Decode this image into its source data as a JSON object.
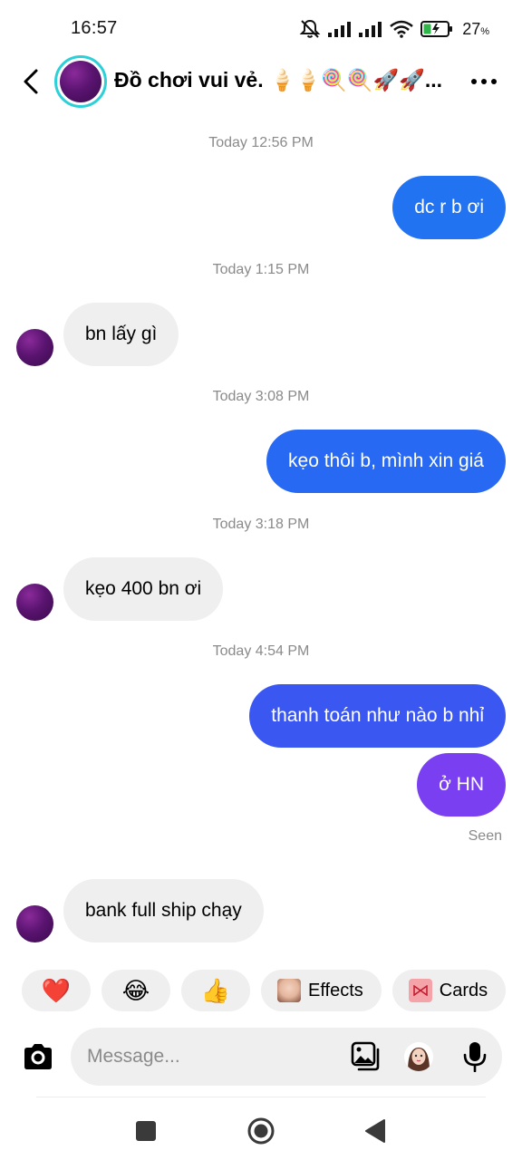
{
  "status_bar": {
    "time": "16:57",
    "battery_percent": "27",
    "battery_unit": "%",
    "icons": [
      "mute-icon",
      "signal-icon",
      "signal-icon",
      "wifi-icon",
      "battery-icon"
    ]
  },
  "header": {
    "title": "Đồ chơi vui vẻ. 🍦🍦🍭🍭🚀🚀...",
    "back_icon": "chevron-left-icon",
    "more_icon": "more-dots-icon"
  },
  "messages": [
    {
      "type": "timestamp",
      "text": "Today 12:56 PM"
    },
    {
      "type": "out",
      "text": "dc r b ơi",
      "color": "#2173f2"
    },
    {
      "type": "timestamp",
      "text": "Today 1:15 PM"
    },
    {
      "type": "in",
      "text": "bn lấy gì"
    },
    {
      "type": "timestamp",
      "text": "Today 3:08 PM"
    },
    {
      "type": "out",
      "text": "kẹo thôi b, mình xin giá",
      "color": "#2769f3"
    },
    {
      "type": "timestamp",
      "text": "Today 3:18 PM"
    },
    {
      "type": "in",
      "text": "kẹo 400 bn ơi"
    },
    {
      "type": "timestamp",
      "text": "Today 4:54 PM"
    },
    {
      "type": "out",
      "text": "thanh toán như nào b nhỉ",
      "color": "#3a57f2"
    },
    {
      "type": "out",
      "text": "ở HN",
      "color": "#7a3ff0"
    },
    {
      "type": "seen",
      "text": "Seen"
    },
    {
      "type": "in",
      "text": "bank full ship chạy"
    }
  ],
  "quick_replies": {
    "reactions": [
      "❤️",
      "😂",
      "👍"
    ],
    "effects_label": "Effects",
    "cards_label": "Cards"
  },
  "composer": {
    "placeholder": "Message...",
    "icons": [
      "camera-icon",
      "gallery-icon",
      "sticker-icon",
      "microphone-icon"
    ]
  },
  "navbar": {
    "icons": [
      "recent-apps-icon",
      "home-icon",
      "back-icon"
    ]
  }
}
